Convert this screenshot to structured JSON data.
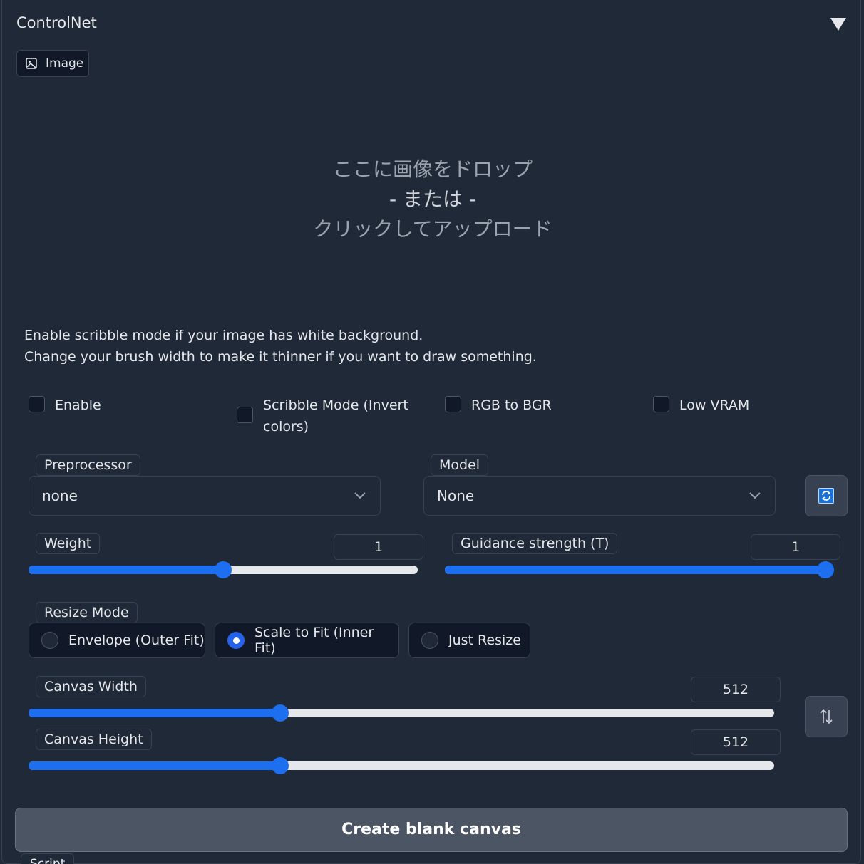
{
  "panel": {
    "title": "ControlNet"
  },
  "image_tab": {
    "label": "Image"
  },
  "drop_zone": {
    "line1": "ここに画像をドロップ",
    "line2": "- または -",
    "line3": "クリックしてアップロード"
  },
  "info": {
    "line1": "Enable scribble mode if your image has white background.",
    "line2": "Change your brush width to make it thinner if you want to draw something."
  },
  "checkboxes": [
    {
      "label": "Enable",
      "checked": false
    },
    {
      "label": "Scribble Mode (Invert colors)",
      "label_line1": "Scribble Mode (Invert",
      "label_line2": "colors)",
      "checked": false
    },
    {
      "label": "RGB to BGR",
      "checked": false
    },
    {
      "label": "Low VRAM",
      "checked": false
    }
  ],
  "preprocessor": {
    "label": "Preprocessor",
    "value": "none"
  },
  "model": {
    "label": "Model",
    "value": "None"
  },
  "weight": {
    "label": "Weight",
    "value": "1",
    "fraction": 0.5
  },
  "guidance": {
    "label": "Guidance strength (T)",
    "value": "1",
    "fraction": 1.0
  },
  "resize_mode": {
    "label": "Resize Mode",
    "options": [
      "Envelope (Outer Fit)",
      "Scale to Fit (Inner Fit)",
      "Just Resize"
    ],
    "selected": "Scale to Fit (Inner Fit)"
  },
  "canvas_width": {
    "label": "Canvas Width",
    "value": "512",
    "fraction": 0.337
  },
  "canvas_height": {
    "label": "Canvas Height",
    "value": "512",
    "fraction": 0.337
  },
  "create_button": {
    "label": "Create blank canvas"
  },
  "script": {
    "label": "Script"
  },
  "colors": {
    "accent": "#1d6ff0",
    "background": "#1f2937",
    "border": "#374151"
  },
  "icons": [
    "chevron-down-icon",
    "image-icon",
    "refresh-icon",
    "swap-icon",
    "collapse-triangle-icon"
  ]
}
